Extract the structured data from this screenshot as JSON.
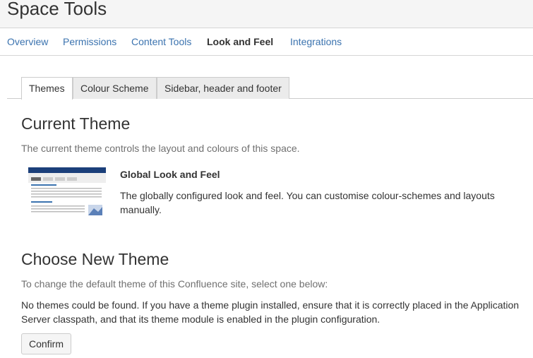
{
  "page": {
    "title": "Space Tools"
  },
  "topnav": {
    "items": [
      {
        "label": "Overview",
        "active": false
      },
      {
        "label": "Permissions",
        "active": false
      },
      {
        "label": "Content Tools",
        "active": false
      },
      {
        "label": "Look and Feel",
        "active": true
      },
      {
        "label": "Integrations",
        "active": false
      }
    ]
  },
  "tabs": {
    "items": [
      {
        "label": "Themes",
        "active": true
      },
      {
        "label": "Colour Scheme",
        "active": false
      },
      {
        "label": "Sidebar, header and footer",
        "active": false
      }
    ]
  },
  "current_theme": {
    "heading": "Current Theme",
    "description": "The current theme controls the layout and colours of this space.",
    "preview_icon": "theme-preview-thumbnail",
    "name": "Global Look and Feel",
    "details": "The globally configured look and feel. You can customise colour-schemes and layouts manually."
  },
  "choose_theme": {
    "heading": "Choose New Theme",
    "description": "To change the default theme of this Confluence site, select one below:",
    "notice": "No themes could be found. If you have a theme plugin installed, ensure that it is correctly placed in the Application Server classpath, and that its theme module is enabled in the plugin configuration.",
    "confirm_label": "Confirm"
  },
  "colors": {
    "link": "#3b73af",
    "text": "#333333",
    "muted": "#707070",
    "header_bg": "#f5f5f5",
    "thumb_accent": "#1b3f7a"
  }
}
